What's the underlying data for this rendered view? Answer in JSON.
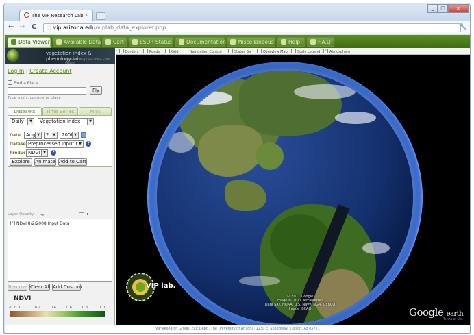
{
  "browser": {
    "tab_title": "The VIP Research Lab.",
    "tab_close": "×",
    "address_url_domain": "vip.arizona.edu",
    "address_url_path": "/viplab_data_explorer.php",
    "nav_back": "←",
    "nav_forward": "→",
    "nav_reload": "C",
    "wrench": "🔧",
    "win_min": "_",
    "win_max": "□",
    "win_close": "x"
  },
  "app_tabs": [
    {
      "label": "Data Viewer",
      "icon": "globe-icon"
    },
    {
      "label": "Available Data",
      "icon": "table-icon"
    },
    {
      "label": "Cart",
      "icon": "cart-icon"
    },
    {
      "label": "ESDR Status",
      "icon": "info-icon"
    },
    {
      "label": "Documentation",
      "icon": "document-icon"
    },
    {
      "label": "Miscellaneous",
      "icon": "misc-icon"
    },
    {
      "label": "Help",
      "icon": "help-icon"
    },
    {
      "label": "F.A.Q",
      "icon": "faq-icon"
    }
  ],
  "banner": {
    "title": "vegetation index & phenology lab",
    "subtitle": "Understanding Land of the Earth system"
  },
  "account": {
    "login": "Log In",
    "separator": "|",
    "create": "Create Account"
  },
  "find": {
    "checkbox_label": "Find a Place",
    "fly_button": "Fly",
    "hint": "Type a city, country or place"
  },
  "sub_tabs": [
    "Datasets",
    "Time Series",
    "Misc"
  ],
  "dataset_panel": {
    "frequency": "Daily",
    "product_type": "Vegetation Index",
    "date_label": "Date",
    "month": "Aug",
    "day": "2",
    "year": "2008",
    "dataset_label": "Dataset",
    "dataset_value": "Preprocessed Input Data",
    "product_label": "Product",
    "product_value": "NDVI",
    "explore": "Explore",
    "animate": "Animate",
    "add_to_cart": "Add to Cart"
  },
  "layers": {
    "opacity_label": "Layer Opacity:",
    "item": "NDVI 8/2/2008 Input Data",
    "remove": "Remove",
    "clear_all": "Clear All",
    "add_custom": "Add Custom"
  },
  "legend": {
    "title": "NDVI",
    "ticks": [
      "-0.2",
      "0",
      "0.2",
      "0.4",
      "0.6",
      "0.8",
      "1.0"
    ]
  },
  "map_options": [
    {
      "label": "Borders",
      "checked": false
    },
    {
      "label": "Roads",
      "checked": false
    },
    {
      "label": "Grid",
      "checked": false
    },
    {
      "label": "Navigation Control",
      "checked": false
    },
    {
      "label": "Status Bar",
      "checked": false
    },
    {
      "label": "Overview Map",
      "checked": false
    },
    {
      "label": "Scale Legend",
      "checked": false
    },
    {
      "label": "Atmosphere",
      "checked": true
    }
  ],
  "map": {
    "credits": [
      "© 2011 Google",
      "Image © 2011 TerraMetrics",
      "Data SIO, NOAA, U.S. Navy, NGA, GEBCO",
      "Image IBCAO"
    ],
    "brand": "Google",
    "brand2": "earth",
    "terms": "Terms of Use",
    "vip_logo_text": "VIP lab."
  },
  "footer": "VIP Research Group, ECE Dept., The University of Arizona, 1230 E. Speedway, Tucson, Az 85721"
}
